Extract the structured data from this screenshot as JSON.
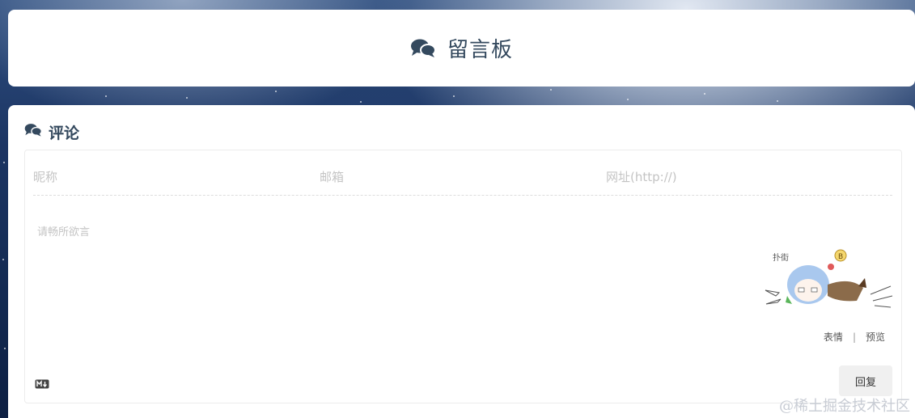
{
  "header": {
    "title": "留言板",
    "icon": "comments-icon"
  },
  "comments": {
    "section_title": "评论",
    "section_icon": "comments-icon",
    "fields": {
      "nickname_placeholder": "昵称",
      "email_placeholder": "邮箱",
      "website_placeholder": "网址(http://)"
    },
    "textarea_placeholder": "请畅所欲言",
    "actions": {
      "emoji_label": "表情",
      "separator": "|",
      "preview_label": "预览"
    },
    "markdown_icon": "markdown-icon",
    "reply_label": "回复",
    "mascot_icon": "anime-mascot-icon",
    "mascot_text": "扑街"
  },
  "watermark": "@稀土掘金技术社区",
  "colors": {
    "card_bg": "#ffffff",
    "title_text": "#34495e",
    "placeholder": "#c4c4c4",
    "button_bg": "#f0f0f0"
  }
}
